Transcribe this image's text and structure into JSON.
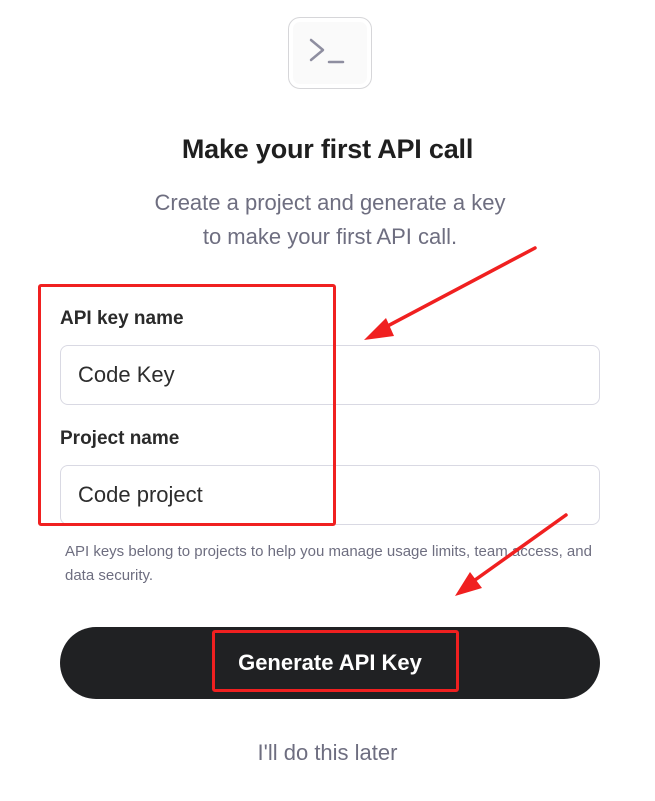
{
  "header": {
    "icon": "terminal-icon",
    "title": "Make your first API call",
    "subtitle": "Create a project and generate a key to make your first API call."
  },
  "form": {
    "api_key_label": "API key name",
    "api_key_value": "Code Key",
    "project_label": "Project name",
    "project_value": "Code project",
    "helper_text": "API keys belong to projects to help you manage usage limits, team access, and data security."
  },
  "actions": {
    "generate_label": "Generate API Key",
    "later_label": "I'll do this later"
  },
  "colors": {
    "button_bg": "#202123",
    "muted_text": "#6e6e80",
    "annotation": "#f02020"
  }
}
